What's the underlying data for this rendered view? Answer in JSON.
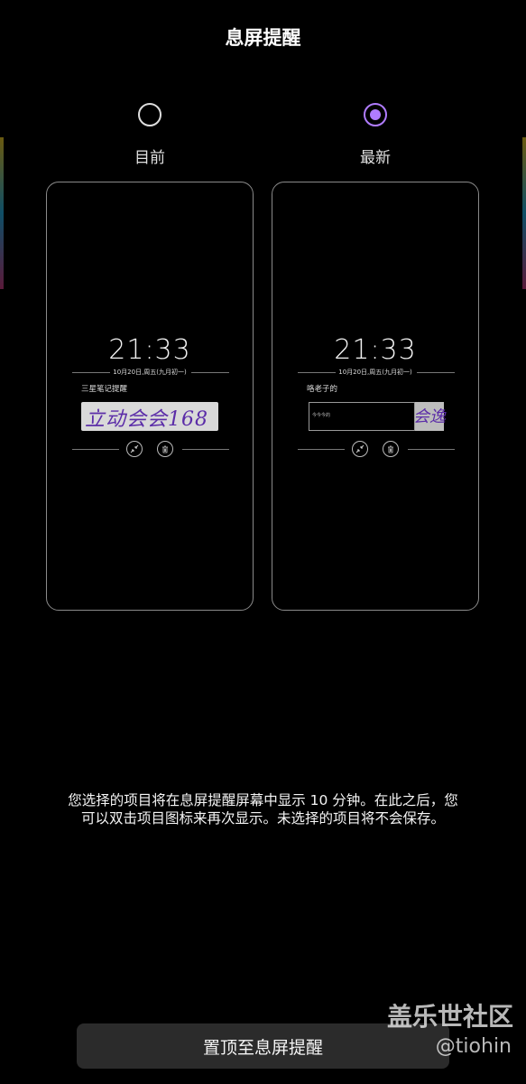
{
  "title": "息屏提醒",
  "options": [
    {
      "label": "目前",
      "selected": false
    },
    {
      "label": "最新",
      "selected": true
    }
  ],
  "accent_color": "#b07cff",
  "preview_current": {
    "time": "21:33",
    "date": "10月20日,周五(九月初一)",
    "memo_title": "三星笔记提醒",
    "handwriting": "立动会会168",
    "icons": [
      "minimize-icon",
      "trash-icon"
    ]
  },
  "preview_new": {
    "time": "21:33",
    "date": "10月20日,周五(九月初一)",
    "memo_title": "咯老子的",
    "box_hint": "今今今的",
    "handwriting": "会逸",
    "icons": [
      "minimize-icon",
      "trash-icon"
    ]
  },
  "description": "您选择的项目将在息屏提醒屏幕中显示 10 分钟。在此之后，您可以双击项目图标来再次显示。未选择的项目将不会保存。",
  "action_button": "置顶至息屏提醒",
  "watermark": {
    "line1": "盖乐世社区",
    "line2": "@tiohin"
  }
}
